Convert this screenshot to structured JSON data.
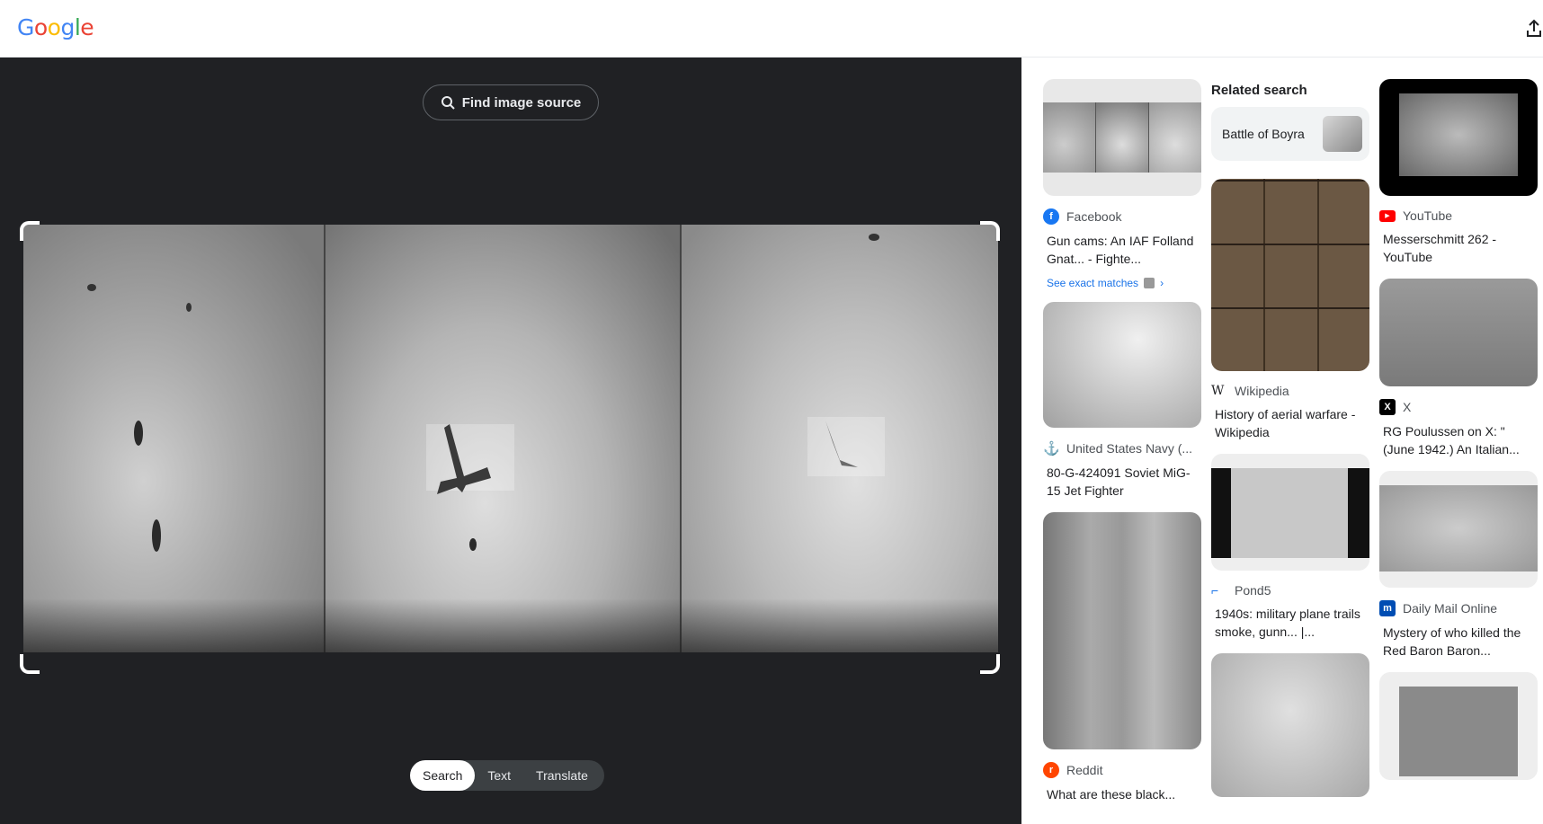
{
  "header": {
    "logo_letters": [
      "G",
      "o",
      "o",
      "g",
      "l",
      "e"
    ],
    "share_icon": "share-upload-icon"
  },
  "viewer": {
    "find_source_label": "Find image source",
    "find_source_icon": "lens-search-icon",
    "tabs": [
      {
        "label": "Search",
        "active": true
      },
      {
        "label": "Text",
        "active": false
      },
      {
        "label": "Translate",
        "active": false
      }
    ]
  },
  "results": {
    "related_heading": "Related search",
    "related_chip": "Battle of Boyra",
    "see_exact": "See exact matches",
    "cards": [
      {
        "source": "Facebook",
        "icon": "facebook-icon",
        "color": "#1877f2",
        "title": "Gun cams: An IAF Folland Gnat... - Fighte..."
      },
      {
        "source": "United States Navy (...",
        "icon": "anchor-icon",
        "color": "#5f6368",
        "title": "80-G-424091 Soviet MiG-15 Jet Fighter"
      },
      {
        "source": "Reddit",
        "icon": "reddit-icon",
        "color": "#ff4500",
        "title": "What are these black..."
      },
      {
        "source": "Wikipedia",
        "icon": "wikipedia-icon",
        "color": "#202124",
        "title": "History of aerial warfare - Wikipedia"
      },
      {
        "source": "Pond5",
        "icon": "pond5-icon",
        "color": "#1a73e8",
        "title": "1940s: military plane trails smoke, gunn... |..."
      },
      {
        "source": "YouTube",
        "icon": "youtube-icon",
        "color": "#ff0000",
        "title": "Messerschmitt 262 - YouTube"
      },
      {
        "source": "X",
        "icon": "x-icon",
        "color": "#000000",
        "title": "RG Poulussen on X: \"(June 1942.) An Italian..."
      },
      {
        "source": "Daily Mail Online",
        "icon": "dailymail-icon",
        "color": "#004db3",
        "title": "Mystery of who killed the Red Baron Baron..."
      }
    ]
  }
}
